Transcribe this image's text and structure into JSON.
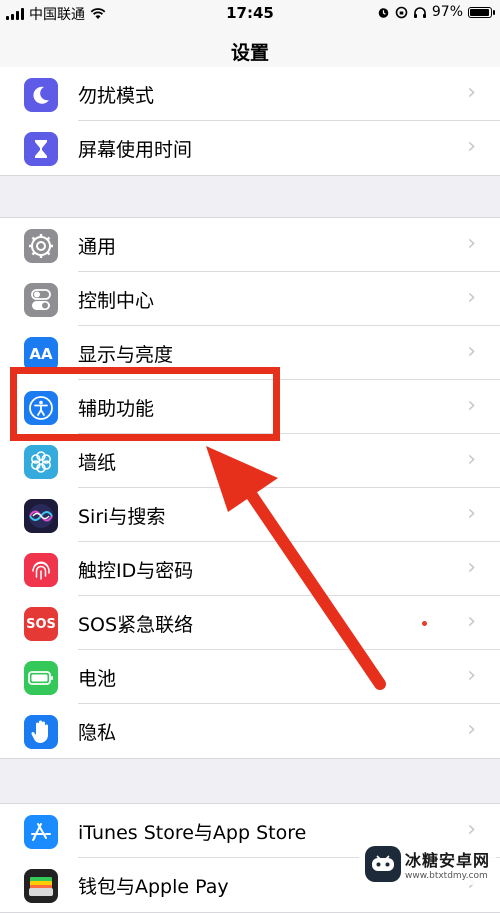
{
  "status_bar": {
    "carrier": "中国联通",
    "time": "17:45",
    "battery_percent": "97%",
    "battery_level": 0.97
  },
  "nav": {
    "title": "设置"
  },
  "group1": [
    {
      "label": "勿扰模式",
      "icon": "moon-icon",
      "color": "#5e5ce6"
    },
    {
      "label": "屏幕使用时间",
      "icon": "hourglass-icon",
      "color": "#5e5ce6"
    }
  ],
  "group2": [
    {
      "label": "通用",
      "icon": "gear-icon",
      "color": "#8e8e93"
    },
    {
      "label": "控制中心",
      "icon": "switches-icon",
      "color": "#8e8e93"
    },
    {
      "label": "显示与亮度",
      "icon": "AA",
      "color": "#1a7cf0"
    },
    {
      "label": "辅助功能",
      "icon": "accessibility-icon",
      "color": "#1a7cf0"
    },
    {
      "label": "墙纸",
      "icon": "flower-icon",
      "color": "#35aadc"
    },
    {
      "label": "Siri与搜索",
      "icon": "siri-icon",
      "color": "#1c1c3a"
    },
    {
      "label": "触控ID与密码",
      "icon": "fingerprint-icon",
      "color": "#f0344c"
    },
    {
      "label": "SOS紧急联络",
      "icon": "SOS",
      "color": "#e53935"
    },
    {
      "label": "电池",
      "icon": "battery-icon",
      "color": "#34c759"
    },
    {
      "label": "隐私",
      "icon": "hand-icon",
      "color": "#1a7cf0"
    }
  ],
  "group3": [
    {
      "label": "iTunes Store与App Store",
      "icon": "app-store-icon",
      "color": "#1a8cff"
    },
    {
      "label": "钱包与Apple Pay",
      "icon": "wallet-icon",
      "color": "#222222"
    }
  ],
  "watermark": {
    "text": "冰糖安卓网",
    "url": "www.btxtdmy.com"
  }
}
